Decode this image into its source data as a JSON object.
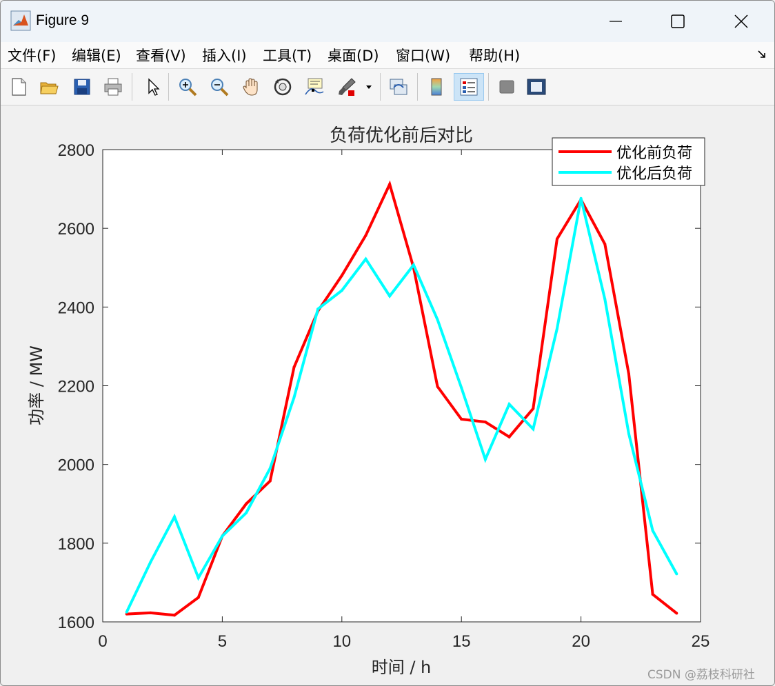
{
  "window": {
    "title": "Figure 9",
    "controls": {
      "minimize": "minimize-icon",
      "maximize": "maximize-icon",
      "close": "close-icon"
    }
  },
  "menubar": {
    "items": [
      {
        "label": "文件(F)"
      },
      {
        "label": "编辑(E)"
      },
      {
        "label": "查看(V)"
      },
      {
        "label": "插入(I)"
      },
      {
        "label": "工具(T)"
      },
      {
        "label": "桌面(D)"
      },
      {
        "label": "窗口(W)"
      },
      {
        "label": "帮助(H)"
      }
    ]
  },
  "toolbar": {
    "buttons": [
      {
        "icon": "new-figure-icon"
      },
      {
        "icon": "open-file-icon"
      },
      {
        "icon": "save-icon"
      },
      {
        "icon": "print-icon"
      },
      {
        "icon": "pointer-icon"
      },
      {
        "icon": "zoom-in-icon"
      },
      {
        "icon": "zoom-out-icon"
      },
      {
        "icon": "pan-hand-icon"
      },
      {
        "icon": "rotate-3d-icon"
      },
      {
        "icon": "data-cursor-icon"
      },
      {
        "icon": "brush-icon"
      },
      {
        "icon": "link-plot-icon"
      },
      {
        "icon": "colorbar-icon"
      },
      {
        "icon": "legend-icon",
        "active": true
      },
      {
        "icon": "hide-plot-tools-icon"
      },
      {
        "icon": "show-plot-tools-icon"
      }
    ]
  },
  "colors": {
    "series1": "#ff0000",
    "series2": "#00ffff",
    "axes_bg": "#ffffff",
    "figure_bg": "#f0f0f0"
  },
  "chart_data": {
    "type": "line",
    "title": "负荷优化前后对比",
    "xlabel": "时间 / h",
    "ylabel": "功率 / MW",
    "xlim": [
      0,
      25
    ],
    "ylim": [
      1600,
      2800
    ],
    "xticks": [
      0,
      5,
      10,
      15,
      20,
      25
    ],
    "yticks": [
      1600,
      1800,
      2000,
      2200,
      2400,
      2600,
      2800
    ],
    "grid": false,
    "legend_position": "top-right",
    "x": [
      1,
      2,
      3,
      4,
      5,
      6,
      7,
      8,
      9,
      10,
      11,
      12,
      13,
      14,
      15,
      16,
      17,
      18,
      19,
      20,
      21,
      22,
      23,
      24
    ],
    "series": [
      {
        "name": "优化前负荷",
        "color": "#ff0000",
        "values": [
          1620,
          1623,
          1617,
          1662,
          1818,
          1900,
          1958,
          2247,
          2390,
          2480,
          2582,
          2712,
          2500,
          2198,
          2115,
          2108,
          2070,
          2142,
          2573,
          2673,
          2560,
          2230,
          1670,
          1622
        ]
      },
      {
        "name": "优化后负荷",
        "color": "#00ffff",
        "values": [
          1625,
          1752,
          1867,
          1712,
          1818,
          1877,
          1990,
          2170,
          2395,
          2442,
          2522,
          2428,
          2507,
          2368,
          2195,
          2013,
          2153,
          2090,
          2345,
          2676,
          2420,
          2078,
          1832,
          1722
        ]
      }
    ]
  },
  "watermark": "CSDN @荔枝科研社"
}
